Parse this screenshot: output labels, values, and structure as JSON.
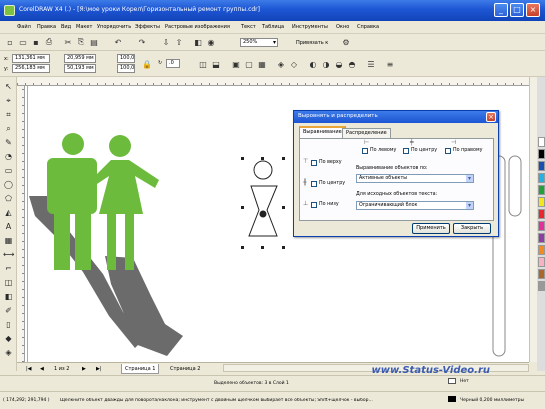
{
  "window": {
    "title": "CorelDRAW X4 (.) - [Я:\\мое уроки Корел\\Горизонтальный ремонт группы.cdr]",
    "controls": [
      "_",
      "□",
      "×"
    ]
  },
  "menu": [
    "Файл",
    "Правка",
    "Вид",
    "Макет",
    "Упорядочить",
    "Эффекты",
    "Растровые изображения",
    "Текст",
    "Таблица",
    "Инструменты",
    "Окно",
    "Справка"
  ],
  "toolbar": {
    "zoom": "250%",
    "snap": "Привязать к",
    "x": "131,361 мм",
    "y": "256,183 мм",
    "w": "20,959 мм",
    "h": "50,193 мм",
    "scale_w": "100,0",
    "scale_h": "100,0",
    "angle": ".0"
  },
  "pages": {
    "info": "1 из 2",
    "tabs": [
      "Страница 1",
      "Страница 2"
    ]
  },
  "status": {
    "selection": "Выделено объектов: 3 в Слой 1",
    "coords": "( 174,292; 291,794 )",
    "hint": "Щелкните объект дважды для поворота/наклона; инструмент с двойным щелчком выбирает все объекты; Shift+щелчок - выбор...",
    "fill_label": "Нет",
    "outline_label": "Черный  0,200 миллиметры"
  },
  "watermark": "www.Status-Video.ru",
  "dialog": {
    "title": "Выровнять и распределить",
    "tabs": [
      "Выравнивание",
      "Распределение"
    ],
    "horiz": [
      "По левому",
      "По центру",
      "По правому"
    ],
    "vert": [
      "По верху",
      "По центру",
      "По низу"
    ],
    "align_to_label": "Выравнивание объектов по:",
    "align_to_value": "Активные объекты",
    "text_source_label": "Для исходных объектов текста:",
    "text_source_value": "Ограничивающий блок",
    "apply": "Применить",
    "close": "Закрыть"
  },
  "colors": {
    "figure_green": "#6cbb3c",
    "shadow_gray": "#6b6b6b"
  }
}
